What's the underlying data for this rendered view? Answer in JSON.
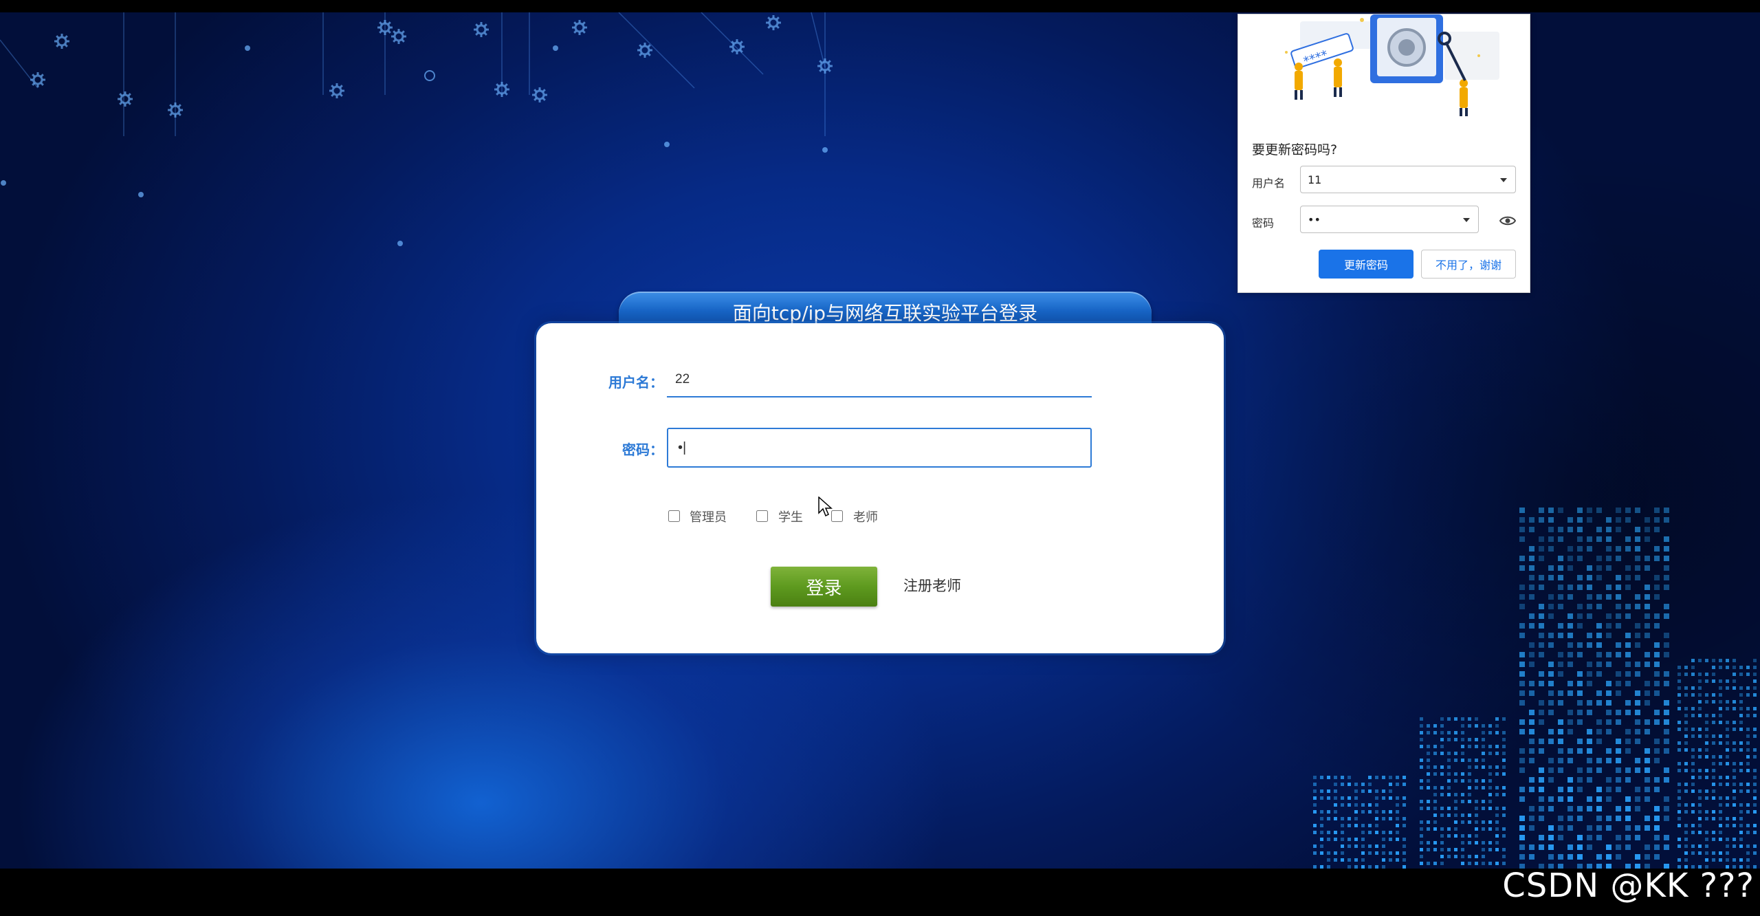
{
  "login": {
    "title": "面向tcp/ip与网络互联实验平台登录",
    "username_label": "用户名：",
    "username_value": "22",
    "password_label": "密码：",
    "password_value": "•|",
    "roles": [
      "管理员",
      "学生",
      "老师"
    ],
    "login_button": "登录",
    "register_link": "注册老师"
  },
  "password_popup": {
    "title": "要更新密码吗?",
    "username_label": "用户名",
    "username_value": "11",
    "password_label": "密码",
    "password_value": "••",
    "update_button": "更新密码",
    "decline_button": "不用了，谢谢",
    "illustration_text": "****"
  },
  "watermark": "CSDN @KK ???",
  "colors": {
    "accent_blue": "#2d7ad6",
    "login_green": "#5e9a1f",
    "popup_blue": "#1a73e8",
    "building_cyan": "#2aa3ff"
  },
  "icons": [
    "eye-icon",
    "cursor-icon",
    "dropdown-caret-icon",
    "gear-icon"
  ]
}
